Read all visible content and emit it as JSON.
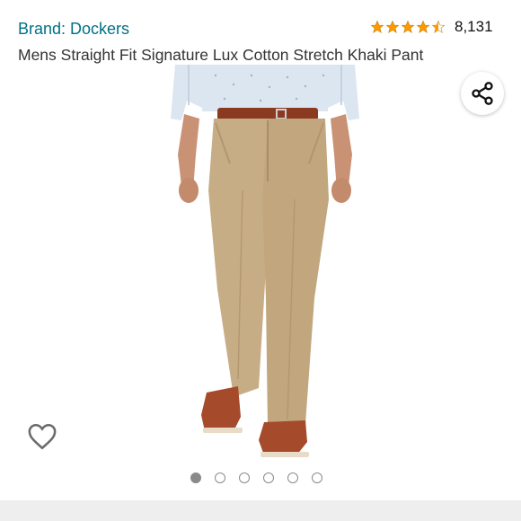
{
  "product": {
    "brand_link": "Brand: Dockers",
    "title": "Mens Straight Fit Signature Lux Cotton Stretch Khaki Pant",
    "rating": 4.5,
    "rating_color": "#ff9900",
    "review_count": "8,131"
  },
  "icons": {
    "share": "share-icon",
    "wishlist": "heart-icon",
    "stars": "star-icon"
  },
  "gallery": {
    "image_subject": "man wearing khaki pants, blue shirt, brown belt and shoes",
    "image_count": 6,
    "active_index": 0
  },
  "colors": {
    "brand_link": "#007185",
    "khaki": "#c7ad86",
    "shirt": "#dbe6f0",
    "belt": "#8b3a22",
    "shoe": "#a54a2a"
  }
}
